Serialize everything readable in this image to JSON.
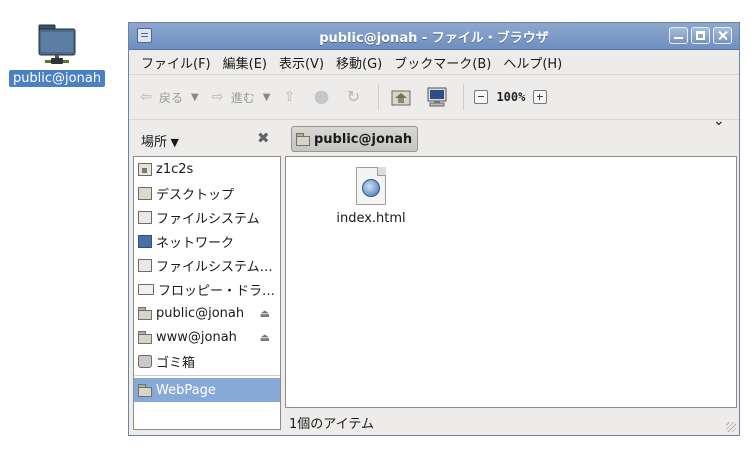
{
  "desktop": {
    "icon_label": "public@jonah"
  },
  "window": {
    "title": "public@jonah - ファイル・ブラウザ"
  },
  "menubar": {
    "items": [
      "ファイル(F)",
      "編集(E)",
      "表示(V)",
      "移動(G)",
      "ブックマーク(B)",
      "ヘルプ(H)"
    ]
  },
  "toolbar": {
    "back_label": "戻る",
    "forward_label": "進む",
    "zoom": "100%",
    "overflow": "⌄"
  },
  "location": {
    "places_label": "場所",
    "path_button": "public@jonah"
  },
  "sidebar": {
    "items": [
      {
        "label": "z1c2s",
        "icon": "home-icon"
      },
      {
        "label": "デスクトップ",
        "icon": "desktop-icon"
      },
      {
        "label": "ファイルシステム",
        "icon": "filesystem-icon"
      },
      {
        "label": "ネットワーク",
        "icon": "network-icon"
      },
      {
        "label": "ファイルシステム…",
        "icon": "drive-icon"
      },
      {
        "label": "フロッピー・ドラ…",
        "icon": "floppy-icon"
      },
      {
        "label": "public@jonah",
        "icon": "network-folder-icon",
        "eject": true
      },
      {
        "label": "www@jonah",
        "icon": "network-folder-icon",
        "eject": true
      },
      {
        "label": "ゴミ箱",
        "icon": "trash-icon"
      }
    ],
    "bookmarks": [
      {
        "label": "WebPage",
        "icon": "folder-icon",
        "selected": true
      }
    ]
  },
  "files": [
    {
      "name": "index.html",
      "icon": "html-file-icon"
    }
  ],
  "status": {
    "text": "1個のアイテム"
  },
  "colors": {
    "titlebar": "#7b98c6",
    "selection": "#87a9d6"
  }
}
